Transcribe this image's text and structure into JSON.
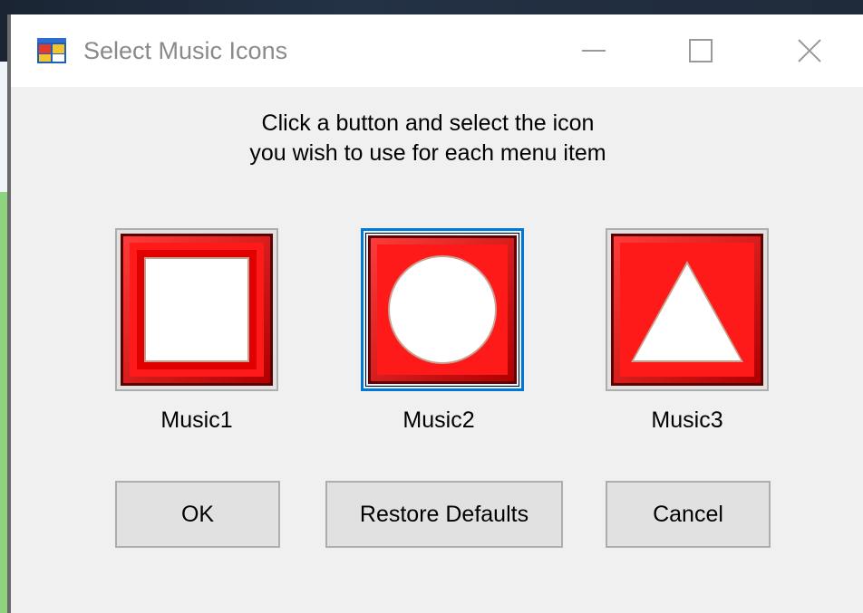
{
  "window": {
    "title": "Select Music Icons",
    "app_icon": "winforms-app-icon",
    "controls": [
      "minimize-icon",
      "maximize-icon",
      "close-icon"
    ]
  },
  "instructions": {
    "line1": "Click a button and select the icon",
    "line2": "you wish to use for each menu item"
  },
  "icon_buttons": [
    {
      "label": "Music1",
      "icon": "square-icon",
      "selected": false
    },
    {
      "label": "Music2",
      "icon": "circle-icon",
      "selected": true
    },
    {
      "label": "Music3",
      "icon": "triangle-icon",
      "selected": false
    }
  ],
  "buttons": {
    "ok": "OK",
    "restore": "Restore Defaults",
    "cancel": "Cancel"
  },
  "colors": {
    "icon_red": "#ff0000",
    "focus_blue": "#0078d7",
    "dialog_bg": "#f0f0f0"
  }
}
